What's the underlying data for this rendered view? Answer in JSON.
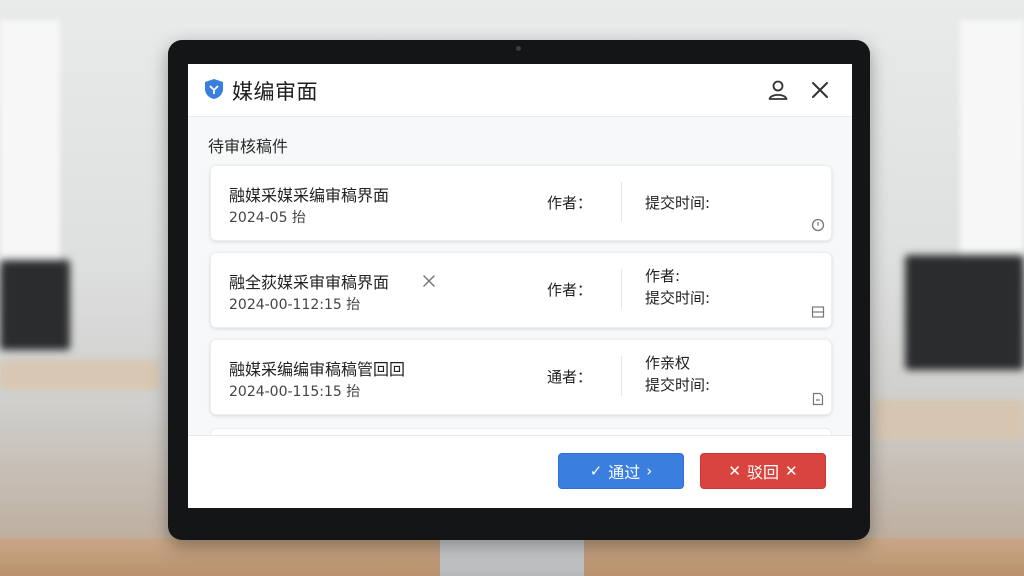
{
  "app": {
    "title": "媒编审面",
    "icon": "shield-app-icon",
    "accent_color": "#3a7fe0"
  },
  "titlebar": {
    "user_icon": "user-icon",
    "close_icon": "close-icon"
  },
  "section": {
    "title": "待审核稿件"
  },
  "items": [
    {
      "title": "融媒采媒采编审稿界面",
      "date": "2024-05 抬",
      "author": "作者：",
      "meta_line1": "提交时间:",
      "meta_line2": "",
      "has_close": false,
      "icon": "clock-icon"
    },
    {
      "title": "融全荻媒采审审稿界面",
      "date": "2024-00-112:15 抬",
      "author": "作者：",
      "meta_line1": "作者:",
      "meta_line2": "提交时间:",
      "has_close": true,
      "icon": "document-icon"
    },
    {
      "title": "融媒采编编审稿稿管回回",
      "date": "2024-00-115:15 抬",
      "author": "通者：",
      "meta_line1": "作亲权",
      "meta_line2": "提交时间:",
      "has_close": false,
      "icon": "page-icon"
    }
  ],
  "actions": {
    "approve_label": "通过",
    "approve_color": "#3a7fe0",
    "reject_label": "驳回",
    "reject_color": "#d9443f"
  }
}
